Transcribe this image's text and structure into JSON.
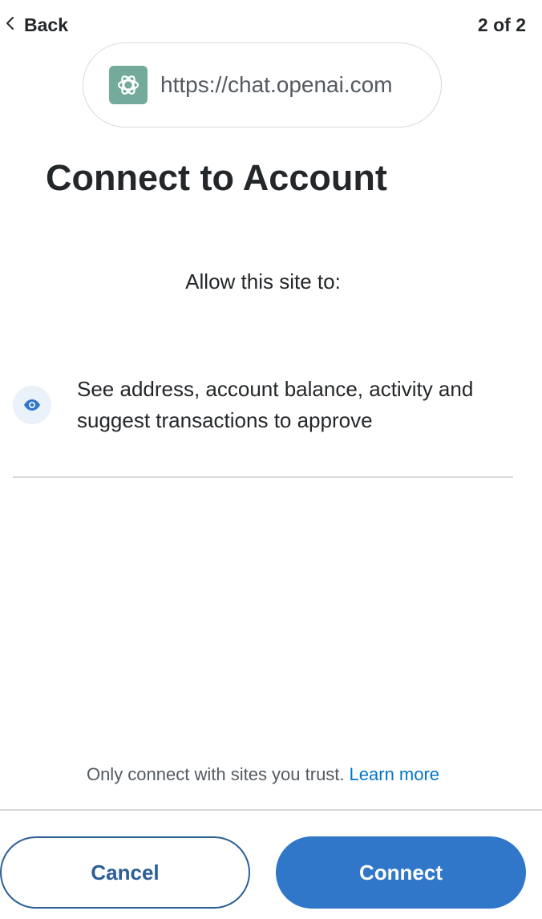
{
  "header": {
    "back_label": "Back",
    "step_counter": "2 of 2"
  },
  "site": {
    "url": "https://chat.openai.com",
    "favicon_icon": "openai-logo-icon",
    "favicon_color": "#74aa9c"
  },
  "title": "Connect to Account",
  "permissions": {
    "heading": "Allow this site to:",
    "items": [
      {
        "icon": "eye-icon",
        "text": "See address, account balance, activity and suggest transactions to approve"
      }
    ]
  },
  "footer": {
    "trust_note": "Only connect with sites you trust.",
    "learn_more": "Learn more",
    "cancel_label": "Cancel",
    "connect_label": "Connect"
  },
  "colors": {
    "primary": "#3077c9",
    "cancel_border": "#2c5f96",
    "link": "#0376c9",
    "divider": "#d6d9dc"
  }
}
